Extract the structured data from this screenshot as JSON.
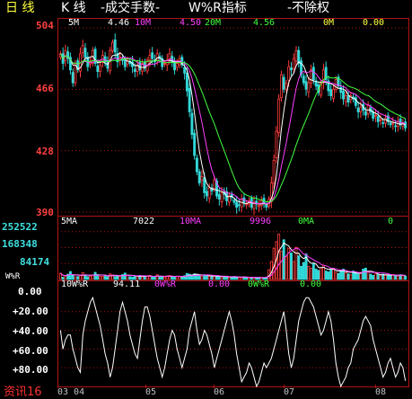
{
  "header": {
    "period": "日 线",
    "chart_type": "K 线",
    "indicator1": "-成交手数-",
    "indicator2": "W%R指标",
    "adjust": "-不除权"
  },
  "colors": {
    "up": "#ff3b3b",
    "down": "#30d8d8",
    "ma5": "#ffffff",
    "ma10": "#ff40ff",
    "ma20": "#40ff40",
    "ma30": "#ffff40",
    "grid": "#b01414",
    "label_price": "#ff4040",
    "label_volume": "#40e0e0"
  },
  "price_panel": {
    "ma_legend": [
      {
        "label": "5M",
        "value": "4.46",
        "color": "#ffffff"
      },
      {
        "label": "10M",
        "value": "4.50",
        "color": "#ff40ff"
      },
      {
        "label": "20M",
        "value": "4.56",
        "color": "#40ff40"
      },
      {
        "label": "0M",
        "value": "0.00",
        "color": "#ffff40"
      }
    ],
    "y_labels": [
      "504",
      "466",
      "428",
      "390"
    ]
  },
  "volume_panel": {
    "ma_legend": [
      {
        "label": "5MA",
        "value": "7022",
        "color": "#ffffff"
      },
      {
        "label": "10MA",
        "value": "9996",
        "color": "#ff40ff"
      },
      {
        "label": "0MA",
        "value": "0",
        "color": "#40ff40"
      }
    ],
    "y_labels": [
      "252522",
      "168348",
      "84174"
    ]
  },
  "wr_panel": {
    "title": "W%R",
    "legend": [
      {
        "label": "10W%R",
        "value": "94.11",
        "color": "#ffffff"
      },
      {
        "label": "0W%R",
        "value": "0.00",
        "color": "#ff40ff"
      },
      {
        "label": "0W%R",
        "value": "0.00",
        "color": "#40ff40"
      }
    ],
    "y_labels": [
      "0.00",
      "+20.00",
      "+40.00",
      "+60.00",
      "+80.00"
    ]
  },
  "x_axis": {
    "labels": [
      "03 04",
      "05",
      "06",
      "07",
      "08"
    ]
  },
  "watermark": "资讯16",
  "chart_data": [
    {
      "type": "candlestick",
      "ylim": [
        3.9,
        5.04
      ],
      "y_ticks": [
        5.04,
        4.66,
        4.28,
        3.9
      ],
      "x_tick_labels": [
        "03 04",
        "05",
        "06",
        "07",
        "08"
      ],
      "closes": [
        4.88,
        4.82,
        4.9,
        4.85,
        4.78,
        4.7,
        4.82,
        4.78,
        4.88,
        4.93,
        4.86,
        4.8,
        4.83,
        4.9,
        4.82,
        4.77,
        4.81,
        4.87,
        4.83,
        4.79,
        4.9,
        4.95,
        4.89,
        4.83,
        4.86,
        4.84,
        4.8,
        4.84,
        4.82,
        4.8,
        4.77,
        4.81,
        4.78,
        4.82,
        4.79,
        4.84,
        4.87,
        4.85,
        4.83,
        4.88,
        4.85,
        4.8,
        4.82,
        4.84,
        4.88,
        4.83,
        4.78,
        4.82,
        4.85,
        4.81,
        4.76,
        4.65,
        4.52,
        4.38,
        4.25,
        4.15,
        4.08,
        4.12,
        4.02,
        4.0,
        4.05,
        4.03,
        4.1,
        4.0,
        3.98,
        4.02,
        4.01,
        3.97,
        4.0,
        3.99,
        3.96,
        3.93,
        3.94,
        3.98,
        3.96,
        3.95,
        3.97,
        3.93,
        3.96,
        3.95,
        3.94,
        3.97,
        3.95,
        3.93,
        3.98,
        4.08,
        4.22,
        4.4,
        4.6,
        4.75,
        4.66,
        4.7,
        4.8,
        4.78,
        4.85,
        4.9,
        4.82,
        4.75,
        4.7,
        4.66,
        4.7,
        4.78,
        4.72,
        4.68,
        4.64,
        4.7,
        4.78,
        4.72,
        4.65,
        4.62,
        4.66,
        4.72,
        4.68,
        4.64,
        4.6,
        4.62,
        4.58,
        4.62,
        4.6,
        4.56,
        4.52,
        4.55,
        4.53,
        4.5,
        4.56,
        4.52,
        4.48,
        4.5,
        4.46,
        4.47,
        4.45,
        4.48,
        4.46,
        4.44,
        4.45,
        4.43,
        4.46,
        4.44,
        4.45,
        4.42
      ],
      "moving_averages": [
        "MA5",
        "MA10",
        "MA20"
      ]
    },
    {
      "type": "bar",
      "title": "成交手数",
      "ylim": [
        0,
        280000
      ],
      "y_ticks": [
        252522,
        168348,
        84174
      ],
      "values": [
        33000,
        12000,
        18000,
        28000,
        42000,
        22000,
        14000,
        16000,
        20000,
        36000,
        25000,
        15000,
        18000,
        22000,
        38000,
        26000,
        16000,
        17000,
        21000,
        13000,
        30000,
        24000,
        14000,
        18000,
        16000,
        26000,
        34000,
        22000,
        15000,
        12000,
        18000,
        16000,
        21000,
        14000,
        16000,
        19000,
        22000,
        15000,
        12000,
        25000,
        17000,
        15000,
        13000,
        18000,
        21000,
        16000,
        14000,
        17000,
        15000,
        13000,
        20000,
        32000,
        28000,
        24000,
        30000,
        26000,
        21000,
        18000,
        25000,
        19000,
        16000,
        14000,
        22000,
        18000,
        15000,
        12000,
        16000,
        14000,
        12000,
        10000,
        16000,
        13000,
        11000,
        12000,
        14000,
        10000,
        9000,
        12000,
        10000,
        8000,
        11000,
        9000,
        10000,
        12000,
        52000,
        95000,
        165000,
        200000,
        240000,
        150000,
        210000,
        120000,
        165000,
        140000,
        95000,
        170000,
        125000,
        70000,
        90000,
        135000,
        70000,
        60000,
        85000,
        55000,
        48000,
        62000,
        75000,
        45000,
        40000,
        52000,
        60000,
        38000,
        32000,
        45000,
        55000,
        36000,
        30000,
        25000,
        45000,
        38000,
        28000,
        32000,
        55000,
        60000,
        42000,
        28000,
        22000,
        30000,
        26000,
        20000,
        28000,
        22000,
        24000,
        20000,
        26000,
        20000,
        18000,
        25000,
        22000,
        18000
      ]
    },
    {
      "type": "line",
      "title": "W%R",
      "ylim": [
        0,
        100
      ],
      "y_ticks": [
        "0.00",
        "+20.00",
        "+40.00",
        "+60.00",
        "+80.00"
      ],
      "inverted": true,
      "series": [
        {
          "name": "10W%R",
          "values": [
            40,
            60,
            50,
            45,
            45,
            60,
            70,
            80,
            85,
            45,
            30,
            20,
            10,
            5,
            15,
            25,
            35,
            50,
            65,
            75,
            90,
            80,
            60,
            40,
            20,
            10,
            20,
            30,
            45,
            55,
            65,
            70,
            50,
            30,
            15,
            15,
            25,
            40,
            55,
            70,
            80,
            90,
            80,
            65,
            50,
            40,
            45,
            60,
            70,
            80,
            70,
            60,
            40,
            30,
            20,
            40,
            55,
            50,
            40,
            45,
            55,
            65,
            80,
            70,
            60,
            50,
            40,
            30,
            20,
            30,
            45,
            65,
            80,
            95,
            90,
            85,
            75,
            80,
            90,
            100,
            95,
            85,
            75,
            80,
            75,
            70,
            60,
            50,
            40,
            30,
            20,
            40,
            65,
            80,
            70,
            50,
            30,
            20,
            10,
            5,
            5,
            10,
            15,
            25,
            35,
            45,
            40,
            30,
            20,
            30,
            50,
            75,
            90,
            100,
            95,
            90,
            80,
            75,
            60,
            55,
            50,
            40,
            30,
            25,
            30,
            35,
            50,
            60,
            70,
            80,
            90,
            85,
            75,
            70,
            80,
            90,
            85,
            75,
            80,
            94
          ]
        }
      ]
    }
  ]
}
